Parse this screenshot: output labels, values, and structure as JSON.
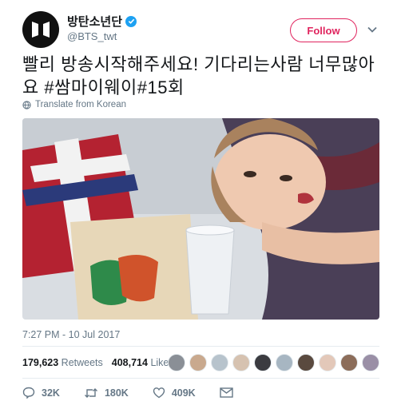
{
  "user": {
    "display_name": "방탄소년단",
    "handle": "@BTS_twt",
    "verified": true,
    "avatar_icon": "bts-logo-icon"
  },
  "follow_button": {
    "label": "Follow",
    "color": "#e0245e"
  },
  "tweet": {
    "text": "빨리 방송시작해주세요! 기다리는사람 너무많아요 #쌈마이웨이#15회",
    "translate_label": "Translate from Korean",
    "timestamp": "7:27 PM - 10 Jul 2017"
  },
  "stats": {
    "retweets_count": "179,623",
    "retweets_label": "Retweets",
    "likes_count": "408,714",
    "likes_label": "Likes",
    "liker_avatars": 10
  },
  "actions": {
    "reply_count": "32K",
    "retweet_count": "180K",
    "like_count": "409K",
    "reply_icon": "reply-icon",
    "retweet_icon": "retweet-icon",
    "like_icon": "heart-icon",
    "dm_icon": "envelope-icon"
  },
  "colors": {
    "accent": "#1da1f2",
    "muted": "#657786",
    "text": "#14171a"
  }
}
